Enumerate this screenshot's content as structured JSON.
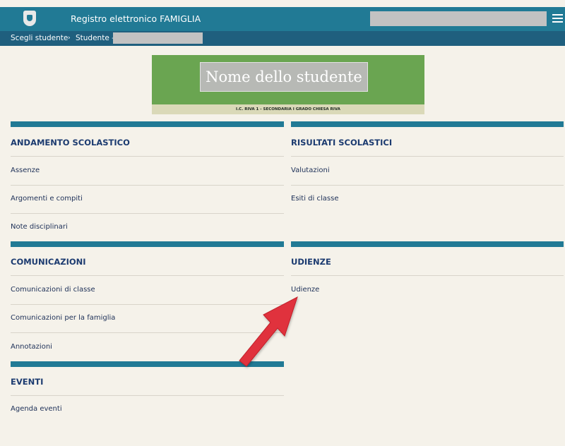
{
  "header": {
    "title": "Registro elettronico FAMIGLIA",
    "logo_icon": "coat-of-arms-icon",
    "menu_icon": "hamburger-menu-icon"
  },
  "breadcrumb": {
    "choose_student": "Scegli studente",
    "separator": "›",
    "student_label": "Studente -"
  },
  "banner": {
    "student_name": "Nome dello studente",
    "school": "I.C. RIVA 1 - SECONDARIA I GRADO CHIESA RIVA"
  },
  "sections": {
    "andamento": {
      "title": "ANDAMENTO SCOLASTICO",
      "items": [
        "Assenze",
        "Argomenti e compiti",
        "Note disciplinari"
      ]
    },
    "risultati": {
      "title": "RISULTATI SCOLASTICI",
      "items": [
        "Valutazioni",
        "Esiti di classe"
      ]
    },
    "comunicazioni": {
      "title": "COMUNICAZIONI",
      "items": [
        "Comunicazioni di classe",
        "Comunicazioni per la famiglia",
        "Annotazioni"
      ]
    },
    "udienze": {
      "title": "UDIENZE",
      "items": [
        "Udienze"
      ]
    },
    "eventi": {
      "title": "EVENTI",
      "items": [
        "Agenda eventi"
      ]
    }
  },
  "colors": {
    "header": "#217a95",
    "breadcrumb": "#1f5f7e",
    "banner": "#6aa551",
    "arrow": "#e0323e",
    "background": "#f5f2ea"
  }
}
